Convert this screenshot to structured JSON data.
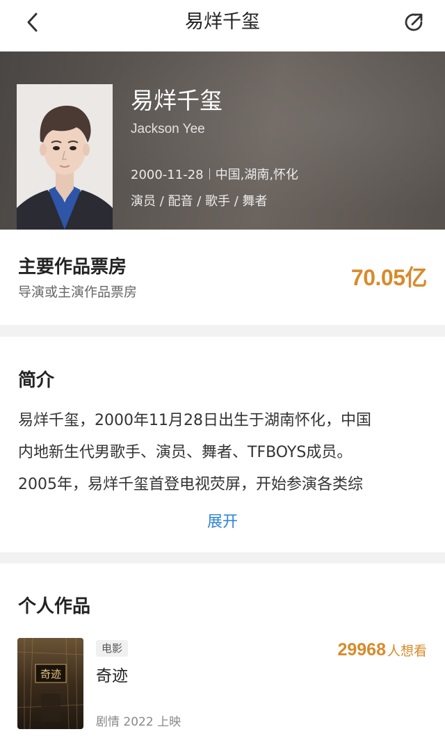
{
  "nav": {
    "title": "易烊千玺",
    "back_icon": "back-arrow-icon",
    "share_icon": "share-icon"
  },
  "profile": {
    "name": "易烊千玺",
    "english_name": "Jackson Yee",
    "birthdate": "2000-11-28",
    "birthplace": "中国,湖南,怀化",
    "roles": "演员 / 配音 / 歌手 / 舞者"
  },
  "box_office": {
    "title": "主要作品票房",
    "subtitle": "导演或主演作品票房",
    "value": "70.05亿"
  },
  "intro": {
    "title": "简介",
    "lines": [
      "易烊千玺，2000年11月28日出生于湖南怀化，中国",
      "内地新生代男歌手、演员、舞者、TFBOYS成员。",
      "2005年，易烊千玺首登电视荧屏，开始参演各类综"
    ],
    "expand_label": "展开"
  },
  "works": {
    "title": "个人作品",
    "items": [
      {
        "tag": "电影",
        "title": "奇迹",
        "meta": "剧情 2022 上映",
        "want_count": "29968",
        "want_label": "人想看",
        "poster_text": "奇迹"
      }
    ]
  },
  "colors": {
    "accent_orange": "#d98a2b",
    "link_blue": "#2f84d6",
    "hero_bg": "#5e5854"
  }
}
